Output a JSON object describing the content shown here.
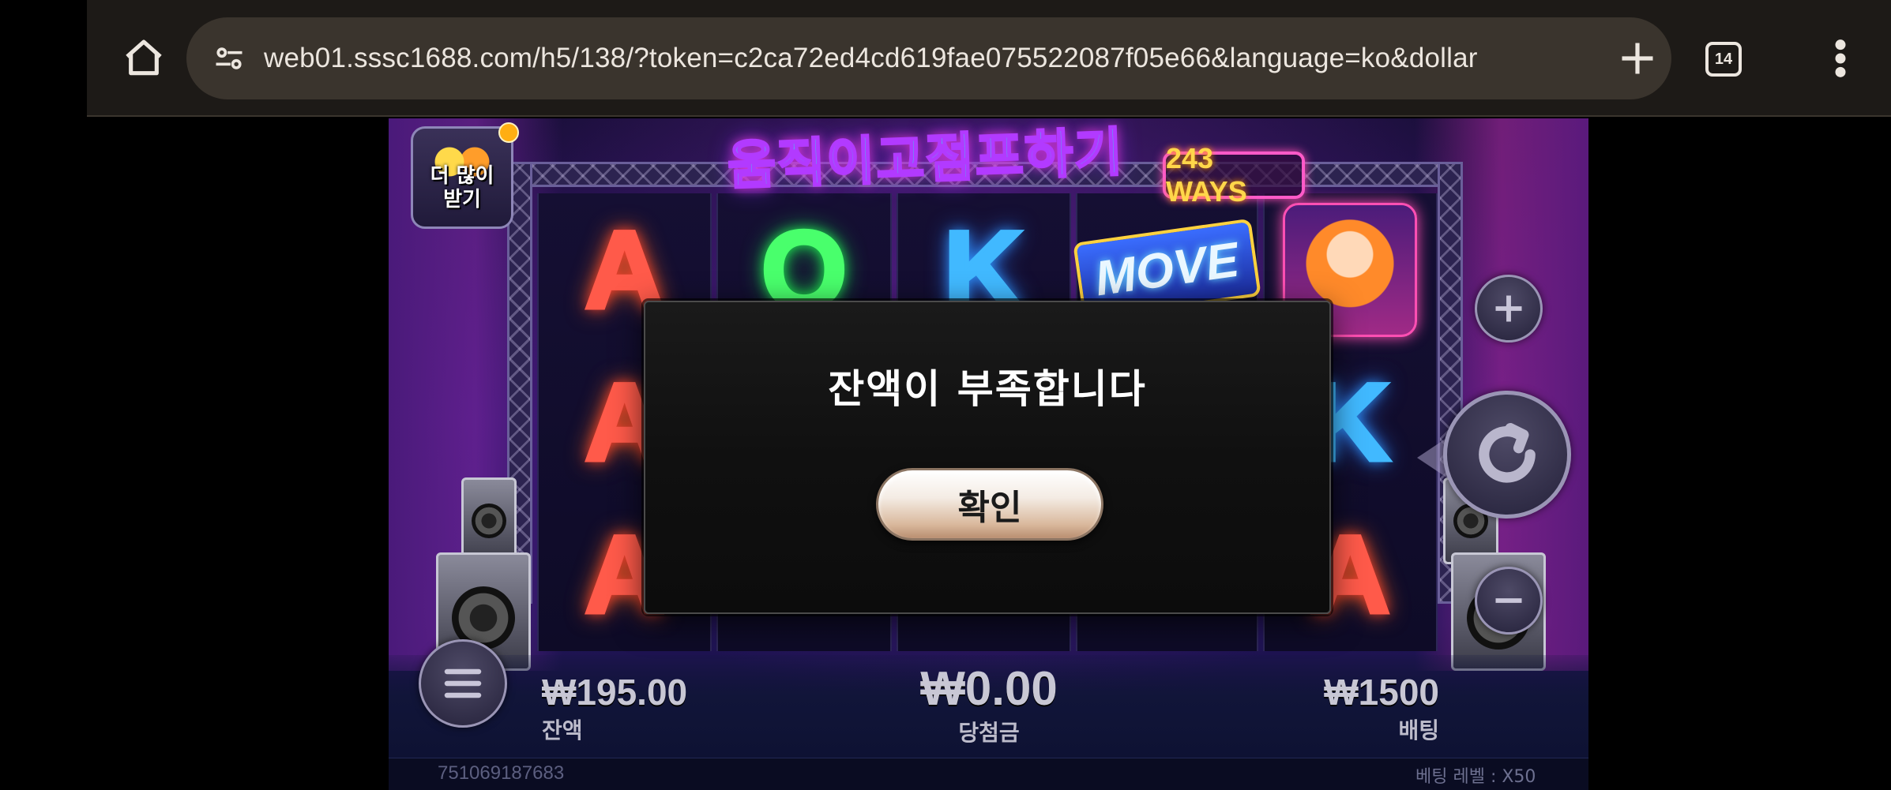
{
  "browser": {
    "url": "web01.sssc1688.com/h5/138/?token=c2ca72ed4cd619fae075522087f05e66&language=ko&dollar",
    "tab_count": "14",
    "icons": {
      "home": "home-icon",
      "site_info": "site-settings-icon",
      "new_tab": "plus-icon",
      "tabs": "tab-switcher-icon",
      "menu": "more-vertical-icon"
    }
  },
  "game": {
    "title": "움직이고점프하기",
    "ways_badge": "243 WAYS",
    "gift_button_label": "더 많이 받기",
    "reels": [
      [
        "A",
        "A",
        "A"
      ],
      [
        "Q",
        "",
        ""
      ],
      [
        "K",
        "",
        ""
      ],
      [
        "MOVE",
        "",
        ""
      ],
      [
        "singer",
        "K",
        "A"
      ]
    ],
    "balance": {
      "value": "₩195.00",
      "label": "잔액"
    },
    "win": {
      "value": "₩0.00",
      "label": "당첨금"
    },
    "bet": {
      "value": "₩1500",
      "label": "배팅"
    },
    "round_id": "751069187683",
    "bet_level": "베팅 레벨 : X50",
    "colors": {
      "neon_red": "#ff5a4a",
      "neon_green": "#49ff6c",
      "neon_blue": "#41b9ff",
      "badge_gold": "#ffd74a"
    }
  },
  "modal": {
    "message": "잔액이 부족합니다",
    "confirm_label": "확인"
  }
}
